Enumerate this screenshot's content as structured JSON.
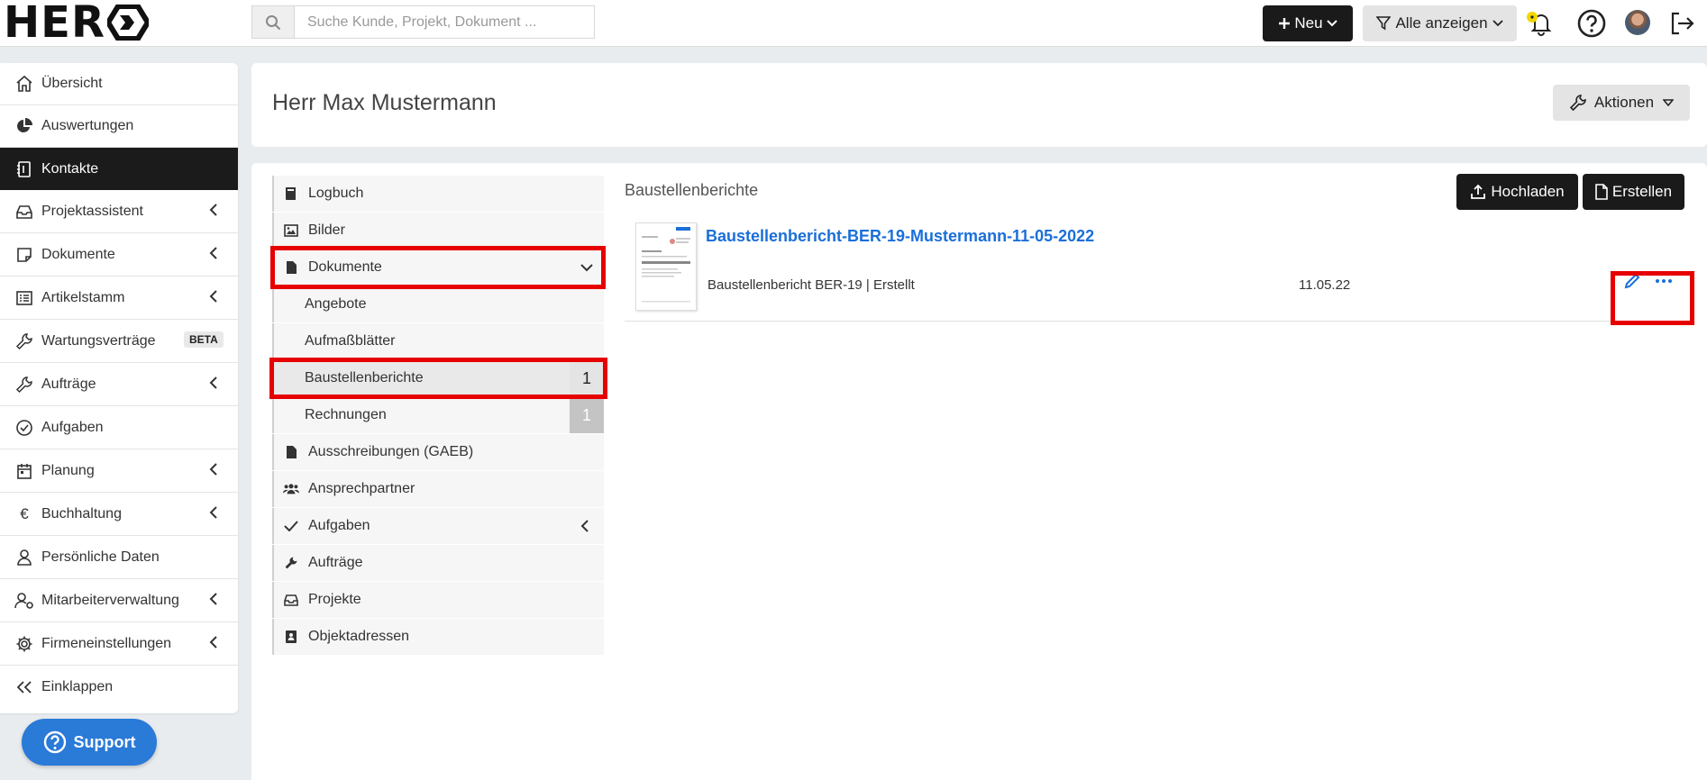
{
  "brand": {
    "logo_text": "HER"
  },
  "search": {
    "placeholder": "Suche Kunde, Projekt, Dokument ..."
  },
  "topbar": {
    "new_label": "Neu",
    "filter_label": "Alle anzeigen"
  },
  "sidebar": {
    "items": [
      {
        "label": "Übersicht"
      },
      {
        "label": "Auswertungen"
      },
      {
        "label": "Kontakte"
      },
      {
        "label": "Projektassistent"
      },
      {
        "label": "Dokumente"
      },
      {
        "label": "Artikelstamm"
      },
      {
        "label": "Wartungsverträge",
        "badge": "BETA"
      },
      {
        "label": "Aufträge"
      },
      {
        "label": "Aufgaben"
      },
      {
        "label": "Planung"
      },
      {
        "label": "Buchhaltung"
      },
      {
        "label": "Persönliche Daten"
      },
      {
        "label": "Mitarbeiterverwaltung"
      },
      {
        "label": "Firmeneinstellungen"
      },
      {
        "label": "Einklappen"
      }
    ],
    "support_label": "Support"
  },
  "header": {
    "contact_name": "Herr Max Mustermann",
    "actions_label": "Aktionen"
  },
  "subnav": {
    "items": [
      {
        "label": "Logbuch"
      },
      {
        "label": "Bilder"
      },
      {
        "label": "Dokumente"
      },
      {
        "label": "Angebote"
      },
      {
        "label": "Aufmaßblätter"
      },
      {
        "label": "Baustellenberichte",
        "count": "1"
      },
      {
        "label": "Rechnungen",
        "count": "1"
      },
      {
        "label": "Ausschreibungen (GAEB)"
      },
      {
        "label": "Ansprechpartner"
      },
      {
        "label": "Aufgaben"
      },
      {
        "label": "Aufträge"
      },
      {
        "label": "Projekte"
      },
      {
        "label": "Objektadressen"
      }
    ]
  },
  "content": {
    "section_title": "Baustellenberichte",
    "upload_label": "Hochladen",
    "create_label": "Erstellen",
    "documents": [
      {
        "title": "Baustellenbericht-BER-19-Mustermann-11-05-2022",
        "meta": "Baustellenbericht BER-19 | Erstellt",
        "date": "11.05.22"
      }
    ]
  },
  "colors": {
    "accent": "#1a6fd8",
    "dark": "#1b1b1b",
    "highlight": "#e60000",
    "support": "#2a7ad8"
  }
}
